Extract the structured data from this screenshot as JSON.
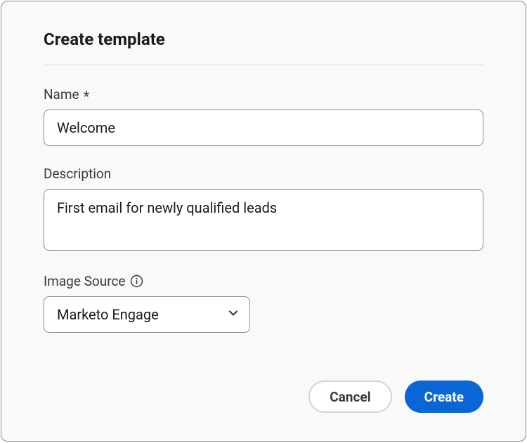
{
  "dialog": {
    "title": "Create template"
  },
  "fields": {
    "name": {
      "label": "Name",
      "required_marker": "*",
      "value": "Welcome"
    },
    "description": {
      "label": "Description",
      "value": "First email for newly qualified leads"
    },
    "image_source": {
      "label": "Image Source",
      "selected": "Marketo Engage"
    }
  },
  "buttons": {
    "cancel": "Cancel",
    "create": "Create"
  },
  "colors": {
    "primary": "#0a66d6",
    "border": "#8a8a8a",
    "divider": "#d4d4d4",
    "text": "#1a1a1a",
    "label": "#3a3a3a",
    "bg": "#f9f9f9"
  }
}
